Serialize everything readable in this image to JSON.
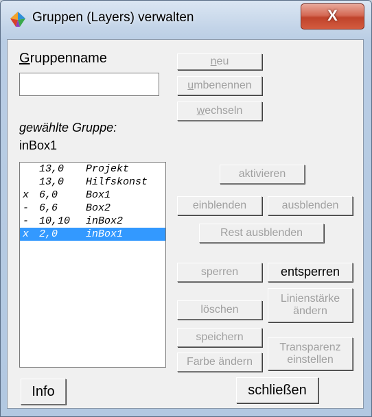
{
  "window": {
    "title": "Gruppen (Layers) verwalten",
    "close_glyph": "X",
    "icon": "app-icon"
  },
  "labels": {
    "gruppenname": "Gruppenname",
    "gewaehlte_gruppe": "gewählte Gruppe:",
    "gewaehlte_gruppe_value": "inBox1"
  },
  "name_input": {
    "value": "",
    "placeholder": ""
  },
  "buttons": {
    "neu": "neu",
    "umbenennen": "umbenennen",
    "wechseln": "wechseln",
    "aktivieren": "aktivieren",
    "einblenden": "einblenden",
    "ausblenden": "ausblenden",
    "rest_ausblenden": "Rest ausblenden",
    "sperren": "sperren",
    "entsperren": "entsperren",
    "loeschen": "löschen",
    "linienstaerke_1": "Linienstärke",
    "linienstaerke_2": "ändern",
    "speichern": "speichern",
    "transparenz_1": "Transparenz",
    "transparenz_2": "einstellen",
    "farbe_aendern": "Farbe ändern",
    "info": "Info",
    "schliessen": "schließen"
  },
  "groups": [
    {
      "flag": " ",
      "nums": "13,0",
      "name": "Projekt",
      "selected": false
    },
    {
      "flag": " ",
      "nums": "13,0",
      "name": "Hilfskonst",
      "selected": false
    },
    {
      "flag": "x",
      "nums": "6,0",
      "name": "Box1",
      "selected": false
    },
    {
      "flag": "-",
      "nums": "6,6",
      "name": "Box2",
      "selected": false
    },
    {
      "flag": "-",
      "nums": "10,10",
      "name": "inBox2",
      "selected": false
    },
    {
      "flag": "x",
      "nums": "2,0",
      "name": "inBox1",
      "selected": true
    }
  ],
  "colors": {
    "selection": "#3399ff",
    "disabled_text": "#a0a0a0",
    "close_button": "#c0432b"
  }
}
